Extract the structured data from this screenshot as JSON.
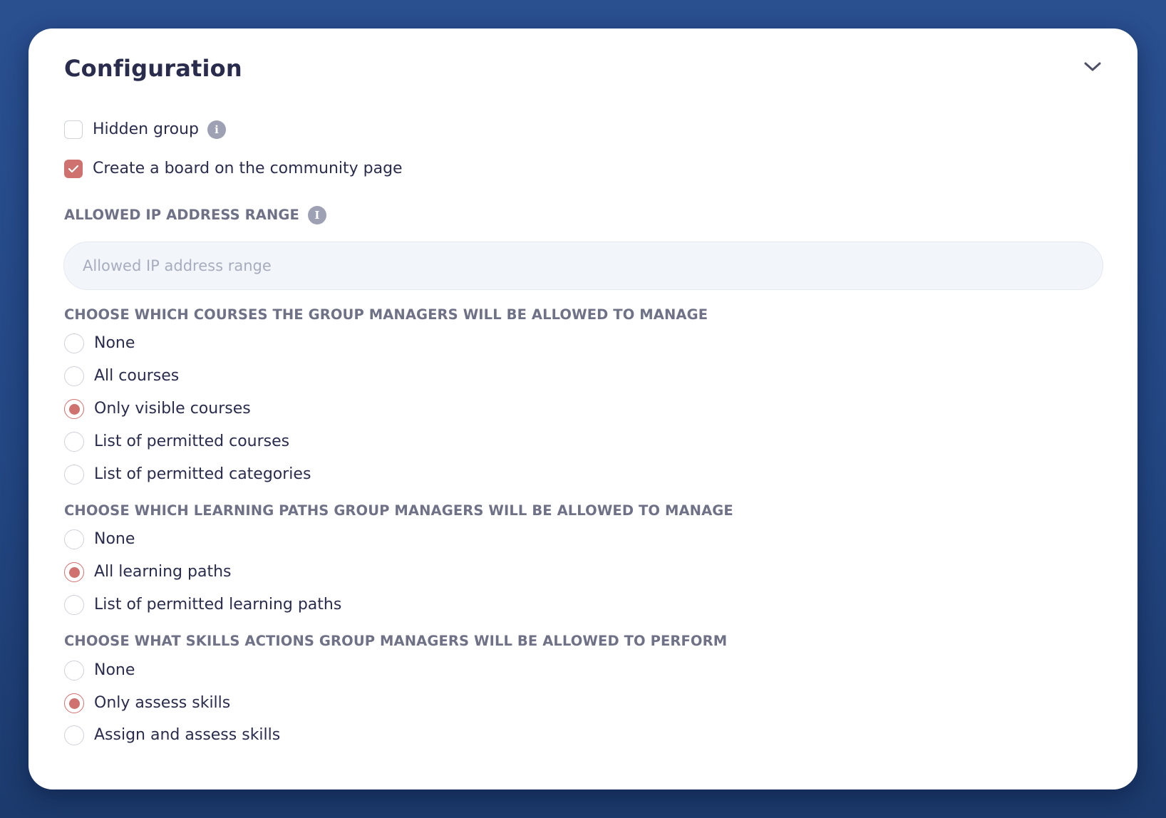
{
  "panel": {
    "title": "Configuration"
  },
  "options": {
    "hidden_group": {
      "label": "Hidden group",
      "checked": false
    },
    "community_board": {
      "label": "Create a board on the community page",
      "checked": true
    }
  },
  "ip_range": {
    "label": "ALLOWED IP ADDRESS RANGE",
    "placeholder": "Allowed IP address range",
    "value": ""
  },
  "courses": {
    "label": "CHOOSE WHICH COURSES THE GROUP MANAGERS WILL BE ALLOWED TO MANAGE",
    "selected": "Only visible courses",
    "items": [
      {
        "label": "None"
      },
      {
        "label": "All courses"
      },
      {
        "label": "Only visible courses"
      },
      {
        "label": "List of permitted courses"
      },
      {
        "label": "List of permitted categories"
      }
    ]
  },
  "learning_paths": {
    "label": "CHOOSE WHICH LEARNING PATHS GROUP MANAGERS WILL BE ALLOWED TO MANAGE",
    "selected": "All learning paths",
    "items": [
      {
        "label": "None"
      },
      {
        "label": "All learning paths"
      },
      {
        "label": "List of permitted learning paths"
      }
    ]
  },
  "skills": {
    "label": "CHOOSE WHAT SKILLS ACTIONS GROUP MANAGERS WILL BE ALLOWED TO PERFORM",
    "selected": "Only assess skills",
    "items": [
      {
        "label": "None"
      },
      {
        "label": "Only assess skills"
      },
      {
        "label": "Assign and assess skills"
      }
    ]
  },
  "icons": {
    "collapse": "chevron-down-icon",
    "info": "info-icon",
    "check": "checkmark-icon"
  },
  "colors": {
    "accent": "#cf716e",
    "title": "#2a2c4e",
    "section_label": "#6f7187",
    "background": "#2a5090"
  }
}
